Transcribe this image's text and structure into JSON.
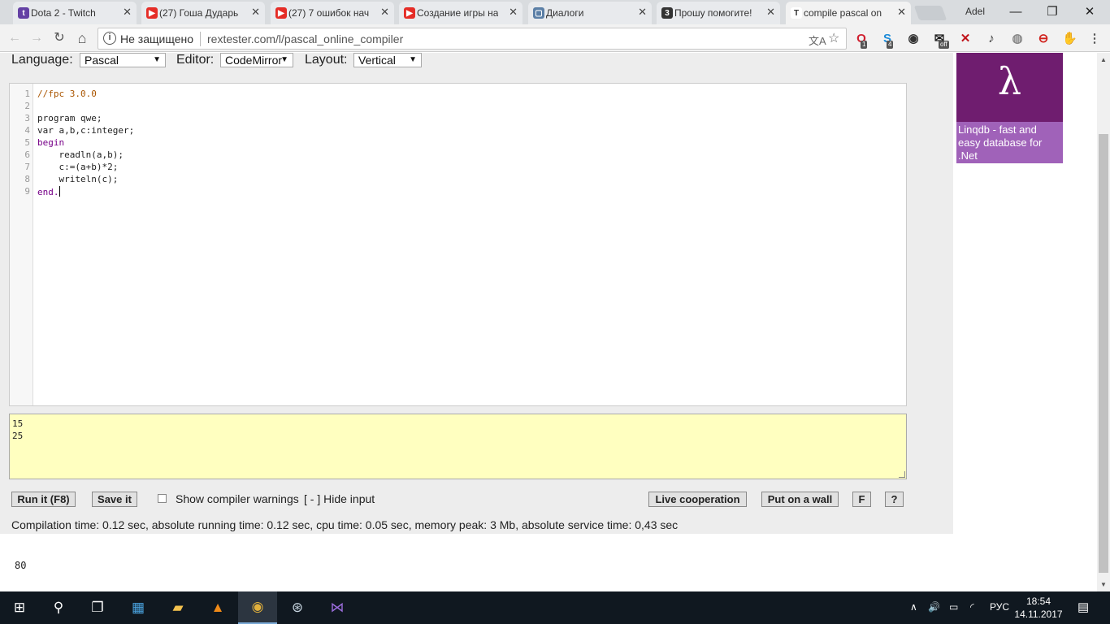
{
  "browser": {
    "tabs": [
      {
        "label": "Dota 2 - Twitch",
        "icon": "twitch-icon",
        "color": "#6441a4",
        "glyph": "t"
      },
      {
        "label": "(27) Гоша Дударь",
        "icon": "youtube-icon",
        "color": "#e52d27",
        "glyph": "▶"
      },
      {
        "label": "(27) 7 ошибок нач",
        "icon": "youtube-icon",
        "color": "#e52d27",
        "glyph": "▶"
      },
      {
        "label": "Создание игры на",
        "icon": "youtube-icon",
        "color": "#e52d27",
        "glyph": "▶"
      },
      {
        "label": "Диалоги",
        "icon": "vk-icon",
        "color": "#5b7fa6",
        "glyph": "▢"
      },
      {
        "label": "Прошу помогите!",
        "icon": "znanija-icon",
        "color": "#333333",
        "glyph": "3"
      },
      {
        "label": "compile pascal on",
        "icon": "rextester-icon",
        "color": "#ffffff",
        "glyph": "T"
      }
    ],
    "tab_close": "✕",
    "profile_name": "Adel",
    "window_controls": {
      "minimize": "—",
      "maximize": "❐",
      "close": "✕"
    },
    "nav": {
      "back": "←",
      "forward": "→",
      "reload": "↻",
      "home": "⌂"
    },
    "address": {
      "info_icon": "i",
      "security_text": "Не защищено",
      "url": "rextester.com/l/pascal_online_compiler",
      "translate_icon": "文A",
      "star_icon": "☆"
    },
    "extensions": [
      {
        "name": "opera-icon",
        "glyph": "O",
        "color": "#d01f2f",
        "badge": "1"
      },
      {
        "name": "skype-icon",
        "glyph": "S",
        "color": "#1a8ad8",
        "badge": "4"
      },
      {
        "name": "location-icon",
        "glyph": "◉",
        "color": "#333333"
      },
      {
        "name": "mail-icon",
        "glyph": "✉",
        "color": "#222222",
        "badge": "off"
      },
      {
        "name": "x-extension-icon",
        "glyph": "✕",
        "color": "#c0141b"
      },
      {
        "name": "music-icon",
        "glyph": "♪",
        "color": "#333333"
      },
      {
        "name": "globe-icon",
        "glyph": "◍",
        "color": "#888888"
      },
      {
        "name": "red-circle-icon",
        "glyph": "⊖",
        "color": "#d0211c"
      },
      {
        "name": "hand-icon",
        "glyph": "✋",
        "color": "#e0432d"
      },
      {
        "name": "menu-icon",
        "glyph": "⋮",
        "color": "#555555"
      }
    ]
  },
  "page": {
    "language_label": "Language:",
    "language_value": "Pascal",
    "editor_label": "Editor:",
    "editor_value": "CodeMirror",
    "layout_label": "Layout:",
    "layout_value": "Vertical",
    "dropdown_arrow": "▼",
    "code_lines": [
      {
        "n": "1",
        "text": "//fpc 3.0.0",
        "kind": "comment"
      },
      {
        "n": "2",
        "text": "",
        "kind": "plain"
      },
      {
        "n": "3",
        "text": "program qwe;",
        "kind": "program"
      },
      {
        "n": "4",
        "text": "var a,b,c:integer;",
        "kind": "var"
      },
      {
        "n": "5",
        "text": "begin",
        "kind": "keyword"
      },
      {
        "n": "6",
        "text": "    readln(a,b);",
        "kind": "plain"
      },
      {
        "n": "7",
        "text": "    c:=(a+b)*2;",
        "kind": "plain"
      },
      {
        "n": "8",
        "text": "    writeln(c);",
        "kind": "plain"
      },
      {
        "n": "9",
        "text": "end.",
        "kind": "keyword"
      }
    ],
    "input_lines": [
      "15",
      "25"
    ],
    "run_button": "Run it (F8)",
    "save_button": "Save it",
    "show_warnings_label": "Show compiler warnings",
    "hide_input_link": "[ - ] Hide input",
    "live_coop_button": "Live cooperation",
    "put_wall_button": "Put on a wall",
    "f_button": "F",
    "help_button": "?",
    "stats": "Compilation time: 0.12 sec, absolute running time: 0.12 sec, cpu time: 0.05 sec, memory peak: 3 Mb, absolute service time: 0,43 sec",
    "output": "80"
  },
  "ad": {
    "logo_glyph": "λ",
    "text": "Linqdb - fast and easy database for .Net"
  },
  "scrollbar": {
    "up": "▲",
    "down": "▼"
  },
  "taskbar": {
    "icons": [
      {
        "name": "windows-start-icon",
        "glyph": "⊞",
        "color": "#ffffff"
      },
      {
        "name": "search-icon",
        "glyph": "⚲",
        "color": "#ffffff"
      },
      {
        "name": "task-view-icon",
        "glyph": "❐",
        "color": "#ffffff"
      },
      {
        "name": "control-panel-icon",
        "glyph": "▦",
        "color": "#4aa3df"
      },
      {
        "name": "file-explorer-icon",
        "glyph": "▰",
        "color": "#f4c24e"
      },
      {
        "name": "avast-icon",
        "glyph": "▲",
        "color": "#f08a18"
      },
      {
        "name": "chrome-icon",
        "glyph": "◉",
        "color": "#e2b13c",
        "active": true
      },
      {
        "name": "steam-icon",
        "glyph": "⊛",
        "color": "#c7d5e0"
      },
      {
        "name": "visual-studio-icon",
        "glyph": "⋈",
        "color": "#9b6ddc"
      }
    ],
    "tray": {
      "chevron": "∧",
      "volume": "🔊",
      "battery": "▭",
      "network": "◜",
      "language": "РУС",
      "notifications": "▤"
    },
    "time": "18:54",
    "date": "14.11.2017"
  }
}
